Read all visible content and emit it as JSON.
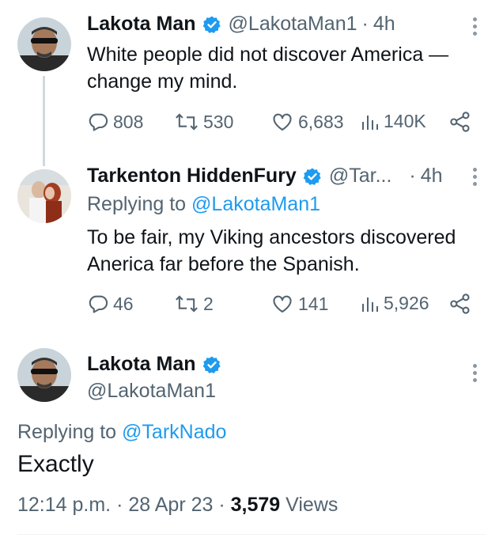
{
  "colors": {
    "accent": "#1d9bf0",
    "secondary_text": "#536471",
    "primary_text": "#0f1419",
    "thread_line": "#cfd9de"
  },
  "tweets": [
    {
      "author": "Lakota Man",
      "handle": "@LakotaMan1",
      "separator": "·",
      "time": "4h",
      "verified": true,
      "text_lines": [
        "White people did not discover America —",
        "change my mind."
      ],
      "actions": {
        "replies": "808",
        "retweets": "530",
        "likes": "6,683",
        "views": "140K"
      }
    },
    {
      "author": "Tarkenton HiddenFury",
      "handle": "@Tar...",
      "separator": "·",
      "time": "4h",
      "verified": true,
      "replying_label": "Replying to",
      "replying_to": "@LakotaMan1",
      "text_lines": [
        "To be fair, my Viking ancestors discovered",
        "Anerica far before the Spanish."
      ],
      "actions": {
        "replies": "46",
        "retweets": "2",
        "likes": "141",
        "views": "5,926"
      }
    }
  ],
  "main_tweet": {
    "author": "Lakota Man",
    "handle": "@LakotaMan1",
    "verified": true,
    "replying_label": "Replying to",
    "replying_to": "@TarkNado",
    "text": "Exactly",
    "time": "12:14 p.m.",
    "sep1": "·",
    "date": "28 Apr 23",
    "sep2": "·",
    "views_count": "3,579",
    "views_label": "Views"
  },
  "icons": [
    "reply-icon",
    "retweet-icon",
    "like-icon",
    "views-icon",
    "share-icon",
    "more-icon",
    "verified-badge-icon"
  ]
}
